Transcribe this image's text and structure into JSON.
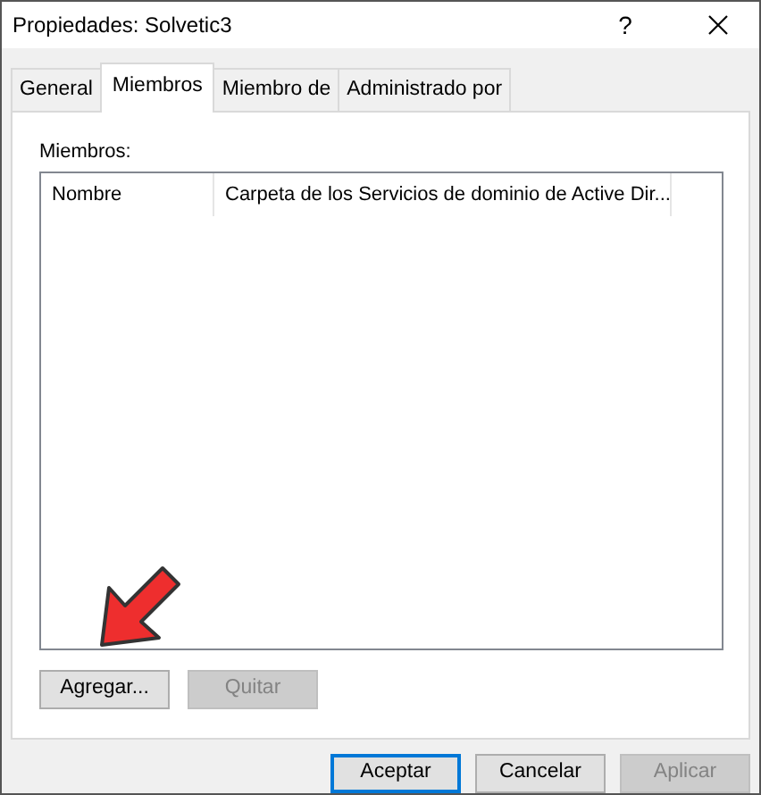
{
  "window": {
    "title": "Propiedades: Solvetic3",
    "help": "?"
  },
  "tabs": [
    {
      "label": "General",
      "selected": false
    },
    {
      "label": "Miembros",
      "selected": true
    },
    {
      "label": "Miembro de",
      "selected": false
    },
    {
      "label": "Administrado por",
      "selected": false
    }
  ],
  "members": {
    "label": "Miembros:",
    "columns": [
      "Nombre",
      "Carpeta de los Servicios de dominio de Active Dir..."
    ],
    "buttons": [
      {
        "label": "Agregar...",
        "disabled": false
      },
      {
        "label": "Quitar",
        "disabled": true
      }
    ]
  },
  "annotation": {
    "kind": "arrow"
  },
  "buttons": [
    {
      "label": "Aceptar",
      "default": true,
      "disabled": false
    },
    {
      "label": "Cancelar",
      "default": false,
      "disabled": false
    },
    {
      "label": "Aplicar",
      "default": false,
      "disabled": true
    }
  ]
}
